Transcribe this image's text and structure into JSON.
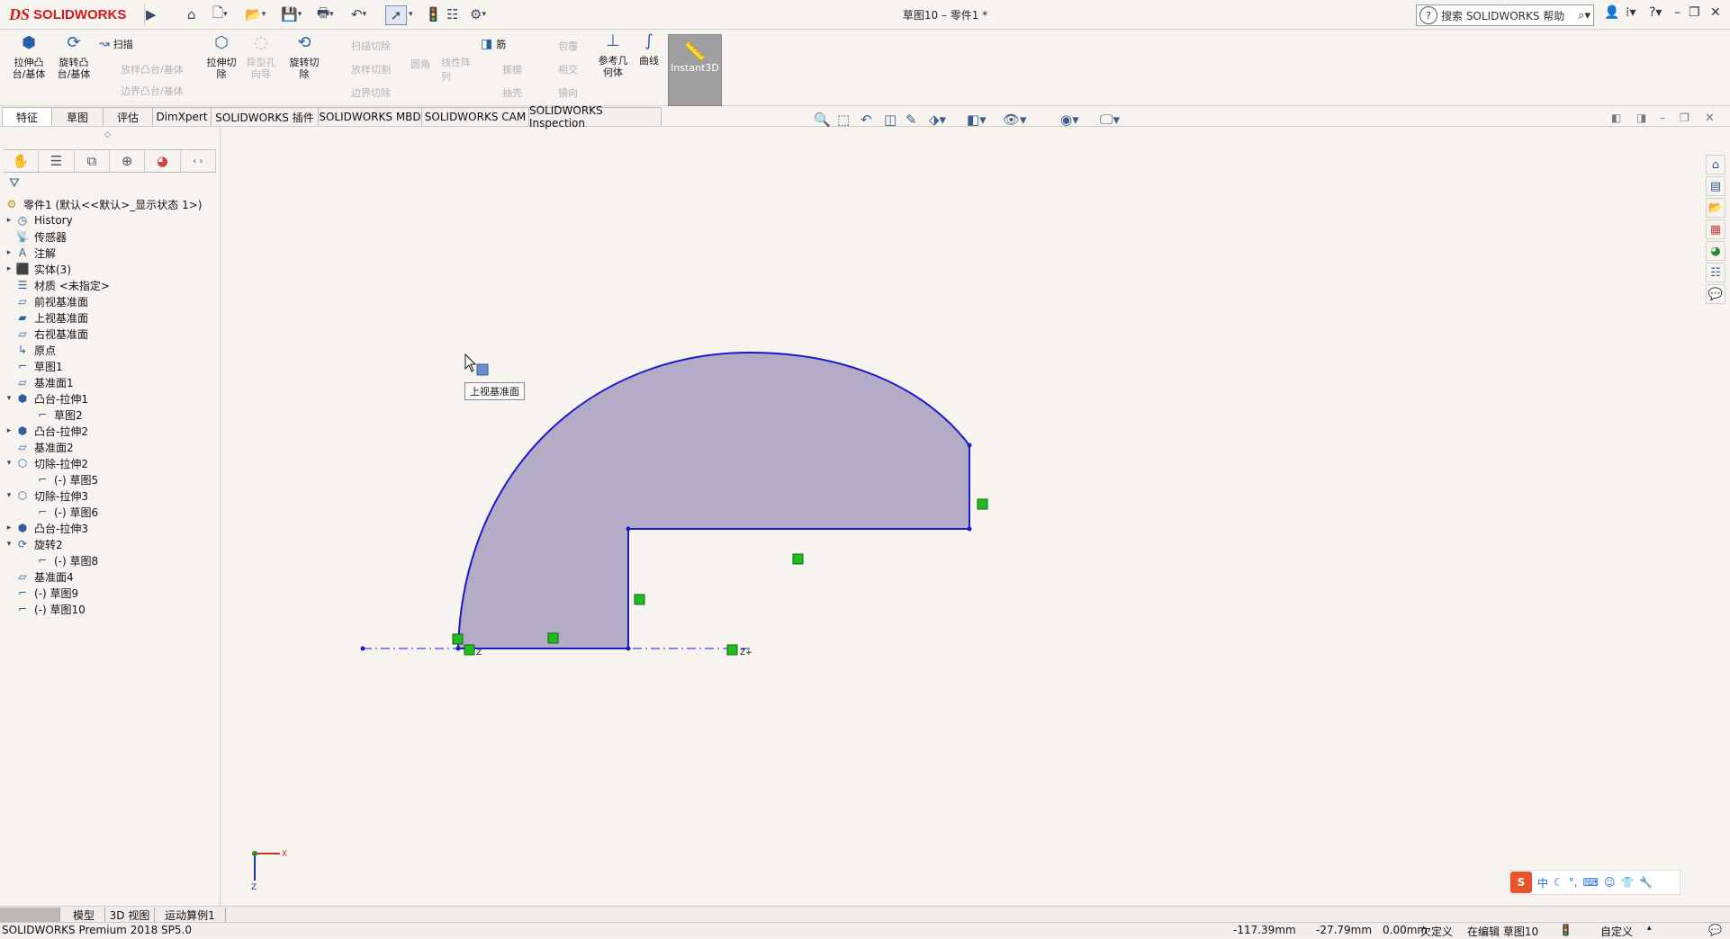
{
  "window": {
    "brand": "SOLIDWORKS",
    "brand_mark": "DS",
    "title": "草图10 – 零件1 *",
    "search_placeholder": "搜索 SOLIDWORKS 帮助"
  },
  "ribbon": {
    "boss_extrude": "拉伸凸\n台/基体",
    "boss_revolve": "旋转凸\n台/基体",
    "sweep": "扫描",
    "loft_boss": "放样凸台/基体",
    "boundary_boss": "边界凸台/基体",
    "cut_extrude": "拉伸切\n除",
    "hole_wizard": "异型孔\n向导",
    "cut_revolve": "旋转切\n除",
    "swept_cut": "扫描切除",
    "lofted_cut": "放样切割",
    "boundary_cut": "边界切除",
    "fillet": "圆角",
    "linear_pattern": "线性阵\n列",
    "rib": "筋",
    "draft": "拔模",
    "shell": "抽壳",
    "wrap": "包覆",
    "intersect": "相交",
    "mirror": "镜向",
    "ref_geometry": "参考几\n何体",
    "curves": "曲线",
    "instant3d": "Instant3D"
  },
  "tabs": [
    "特征",
    "草图",
    "评估",
    "DimXpert",
    "SOLIDWORKS 插件",
    "SOLIDWORKS MBD",
    "SOLIDWORKS CAM",
    "SOLIDWORKS Inspection"
  ],
  "tree": {
    "root": "零件1 (默认<<默认>_显示状态 1>)",
    "items": [
      {
        "label": "History"
      },
      {
        "label": "传感器"
      },
      {
        "label": "注解"
      },
      {
        "label": "实体(3)"
      },
      {
        "label": "材质 <未指定>"
      },
      {
        "label": "前视基准面"
      },
      {
        "label": "上视基准面"
      },
      {
        "label": "右视基准面"
      },
      {
        "label": "原点"
      },
      {
        "label": "草图1"
      },
      {
        "label": "基准面1"
      },
      {
        "label": "凸台-拉伸1"
      },
      {
        "label": "草图2"
      },
      {
        "label": "凸台-拉伸2"
      },
      {
        "label": "基准面2"
      },
      {
        "label": "切除-拉伸2"
      },
      {
        "label": "(-) 草图5"
      },
      {
        "label": "切除-拉伸3"
      },
      {
        "label": "(-) 草图6"
      },
      {
        "label": "凸台-拉伸3"
      },
      {
        "label": "旋转2"
      },
      {
        "label": "(-) 草图8"
      },
      {
        "label": "基准面4"
      },
      {
        "label": "(-) 草图9"
      },
      {
        "label": "(-) 草图10"
      }
    ]
  },
  "canvas": {
    "tooltip": "上视基准面",
    "axis_x": "X",
    "axis_z": "Z",
    "sketch_label_z": "Z",
    "sketch_label_zp": "Z+"
  },
  "ime": {
    "label": "中"
  },
  "bottom_tabs": [
    "模型",
    "3D 视图",
    "运动算例1"
  ],
  "status": {
    "product": "SOLIDWORKS Premium 2018 SP5.0",
    "x": "-117.39mm",
    "y": "-27.79mm",
    "z": "0.00mm",
    "state": "欠定义",
    "editing": "在编辑 草图10",
    "units": "自定义"
  },
  "colors": {
    "sketch_line": "#1a1acc",
    "sketch_fill": "#b4acc6",
    "relation_marker": "#22bb22",
    "brand_red": "#d3181f"
  }
}
